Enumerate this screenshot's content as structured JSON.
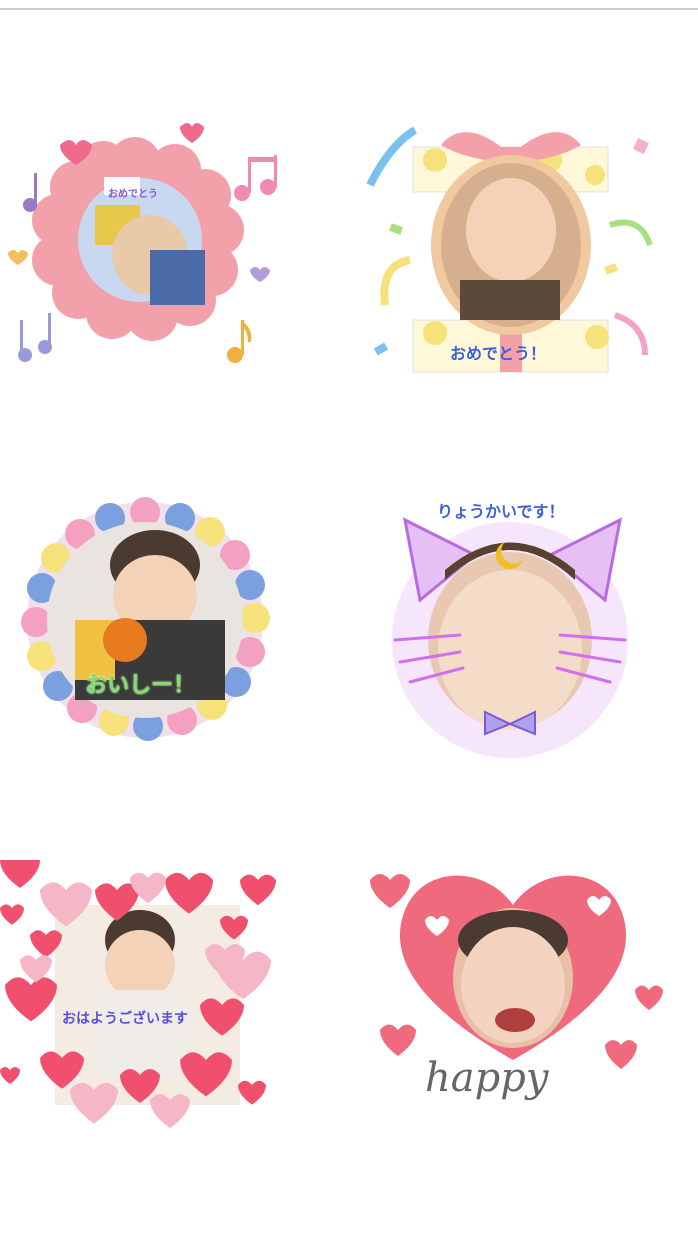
{
  "colors": {
    "pink": "#f2a1aa",
    "heart_red": "#f0506e",
    "heart_pink": "#f5b6c6",
    "blue": "#3b5fd9",
    "grid_bg": "#ffffff"
  },
  "stickers": [
    {
      "caption": "おめでとう",
      "icon": "flower-frame-icon"
    },
    {
      "caption": "おめでとう！",
      "icon": "gift-frame-icon"
    },
    {
      "caption": "おいしー！",
      "icon": "dot-circle-frame-icon"
    },
    {
      "caption": "りょうかいです！",
      "icon": "cat-ears-frame-icon"
    },
    {
      "caption": "おはようございます",
      "icon": "hearts-frame-icon"
    },
    {
      "caption": "happy",
      "icon": "big-heart-frame-icon"
    }
  ]
}
